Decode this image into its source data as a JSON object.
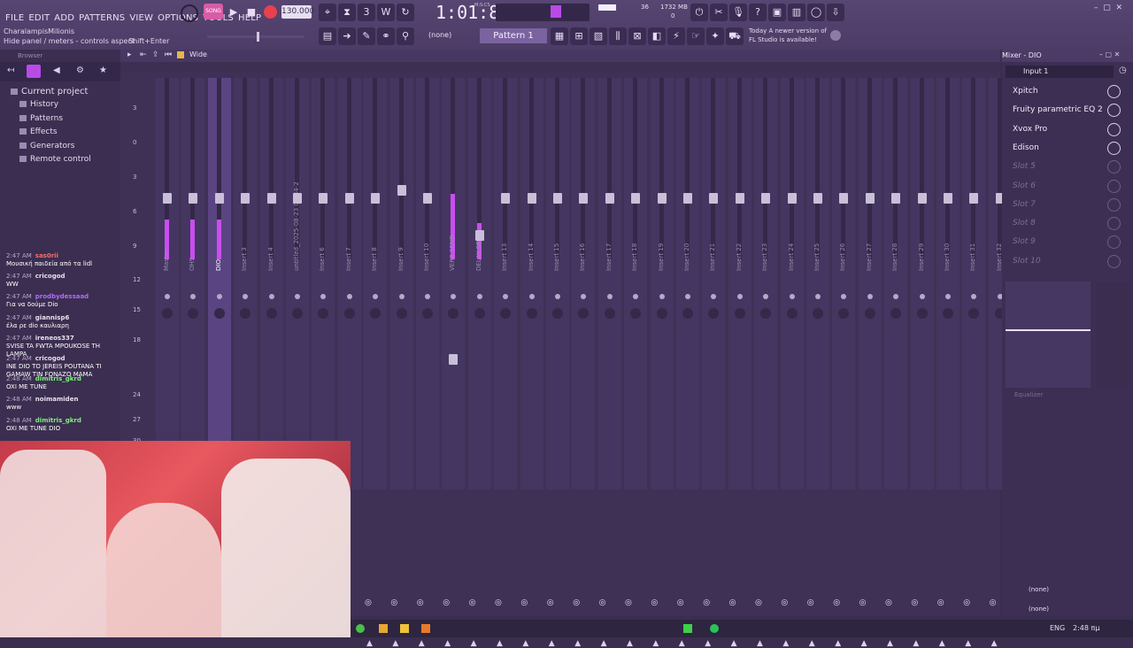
{
  "menu": [
    "FILE",
    "EDIT",
    "ADD",
    "PATTERNS",
    "VIEW",
    "OPTIONS",
    "TOOLS",
    "HELP"
  ],
  "hint": {
    "title": "CharalampisMilionis",
    "text": "Hide panel / meters - controls aspect",
    "shortcut": "Shift+Enter"
  },
  "transport": {
    "mode": "SONG",
    "tempo": "130.000",
    "time": "1:01:84",
    "time_label": "M:S:CS",
    "cpu": "36",
    "memory": "1732 MB",
    "mem_alt": "0"
  },
  "pattern": {
    "snap": "(none)",
    "name": "Pattern 1"
  },
  "news": {
    "line1": "Today  A newer version of",
    "line2": "FL Studio is available!"
  },
  "browser": {
    "title": "Browser",
    "items": [
      "Current project",
      "History",
      "Patterns",
      "Effects",
      "Generators",
      "Remote control"
    ]
  },
  "chat": [
    {
      "time": "2:47 AM",
      "user": "sas0rii",
      "msg": "Μουσική παιδεία από τα lidl",
      "color": "#ff6a6a"
    },
    {
      "time": "2:47 AM",
      "user": "cricogod",
      "msg": "WW",
      "color": "#ffffff"
    },
    {
      "time": "2:47 AM",
      "user": "prodbydessaad",
      "msg": "Για να δούμε Dio",
      "color": "#b06cff"
    },
    {
      "time": "2:47 AM",
      "user": "giannisp6",
      "msg": "έλα ρε dio καυλιαρη",
      "color": "#ffffff"
    },
    {
      "time": "2:47 AM",
      "user": "ireneos337",
      "msg": "SVISE TA FWTA MPOUKOSE TH LAMPA",
      "color": "#ffffff"
    },
    {
      "time": "2:47 AM",
      "user": "cricogod",
      "msg": "INE DIO TO JEREIS POUTANA TI GAMAW TIN FONAZO MAMA",
      "color": "#ffffff"
    },
    {
      "time": "2:48 AM",
      "user": "dimitris_gkrd",
      "msg": "OXI ME TUNE",
      "color": "#7cf07c"
    },
    {
      "time": "2:48 AM",
      "user": "noimamiden",
      "msg": "www",
      "color": "#ffffff"
    },
    {
      "time": "2:48 AM",
      "user": "dimitris_gkrd",
      "msg": "OXI ME TUNE DIO",
      "color": "#7cf07c"
    }
  ],
  "mixer_toolbar": {
    "view": "Wide"
  },
  "mixer_panel": {
    "title": "Mixer - DIO",
    "input": "Input 1",
    "out_none_1": "(none)",
    "out_none_2": "(none)",
    "eq_label": "Equalizer"
  },
  "slots": [
    "Xpitch",
    "Fruity parametric EQ 2",
    "Xvox Pro",
    "Edison",
    "Slot 5",
    "Slot 6",
    "Slot 7",
    "Slot 8",
    "Slot 9",
    "Slot 10"
  ],
  "levels": [
    "3",
    "0",
    "3",
    "6",
    "9",
    "12",
    "15",
    "18",
    "24",
    "27",
    "30"
  ],
  "tracks": [
    {
      "name": "Master",
      "fader": 0.72
    },
    {
      "name": "OHS",
      "fader": 0.72
    },
    {
      "name": "DIO",
      "fader": 0.72
    },
    {
      "name": "Insert 3",
      "fader": 0.72
    },
    {
      "name": "Insert 4",
      "fader": 0.72
    },
    {
      "name": "untitled_2025-08-23 02-34-28_Insert 1",
      "fader": 0.72
    },
    {
      "name": "Insert 6",
      "fader": 0.72
    },
    {
      "name": "Insert 7",
      "fader": 0.72
    },
    {
      "name": "Insert 8",
      "fader": 0.72
    },
    {
      "name": "Insert 9",
      "fader": 0.74
    },
    {
      "name": "Insert 10",
      "fader": 0.72
    },
    {
      "name": "VERB SEND",
      "fader": 0.33
    },
    {
      "name": "DELAY SEND",
      "fader": 0.63
    },
    {
      "name": "Insert 13",
      "fader": 0.72
    },
    {
      "name": "Insert 14",
      "fader": 0.72
    },
    {
      "name": "Insert 15",
      "fader": 0.72
    },
    {
      "name": "Insert 16",
      "fader": 0.72
    },
    {
      "name": "Insert 17",
      "fader": 0.72
    },
    {
      "name": "Insert 18",
      "fader": 0.72
    },
    {
      "name": "Insert 19",
      "fader": 0.72
    },
    {
      "name": "Insert 20",
      "fader": 0.72
    },
    {
      "name": "Insert 21",
      "fader": 0.72
    },
    {
      "name": "Insert 22",
      "fader": 0.72
    },
    {
      "name": "Insert 23",
      "fader": 0.72
    },
    {
      "name": "Insert 24",
      "fader": 0.72
    },
    {
      "name": "Insert 25",
      "fader": 0.72
    },
    {
      "name": "Insert 26",
      "fader": 0.72
    },
    {
      "name": "Insert 27",
      "fader": 0.72
    },
    {
      "name": "Insert 28",
      "fader": 0.72
    },
    {
      "name": "Insert 29",
      "fader": 0.72
    },
    {
      "name": "Insert 30",
      "fader": 0.72
    },
    {
      "name": "Insert 31",
      "fader": 0.72
    },
    {
      "name": "Insert 32",
      "fader": 0.72
    }
  ],
  "taskbar": {
    "lang": "ENG",
    "clock": "2:48 πμ"
  },
  "colors": {
    "accent": "#b84ae6",
    "meter": "#c94ef0",
    "bg": "#3a2d4f"
  }
}
